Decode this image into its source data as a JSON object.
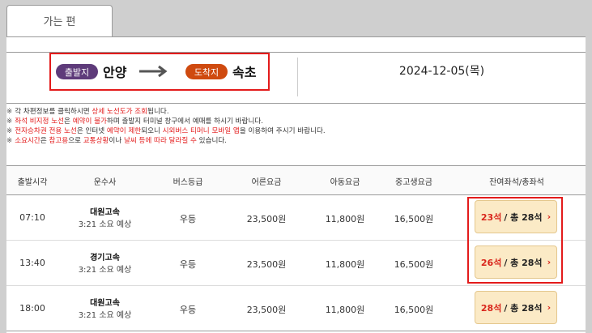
{
  "tab": {
    "label": "가는 편"
  },
  "route": {
    "departure_label": "출발지",
    "departure_city": "안양",
    "arrival_label": "도착지",
    "arrival_city": "속초",
    "date": "2024-12-05(목)"
  },
  "notices": [
    {
      "mark": "※",
      "parts": [
        [
          "각 차편정보를 클릭하시면 ",
          false
        ],
        [
          "상세 노선도가 조회",
          true
        ],
        [
          "됩니다.",
          false
        ]
      ]
    },
    {
      "mark": "※",
      "parts": [
        [
          "좌석 비지정 노선",
          true
        ],
        [
          "은 ",
          false
        ],
        [
          "예약이 불가",
          true
        ],
        [
          "하며 출발지 터미널 창구에서 예매를 하시기 바랍니다.",
          false
        ]
      ]
    },
    {
      "mark": "※",
      "parts": [
        [
          "전자승차권 전용 노선",
          true
        ],
        [
          "은 인터넷 ",
          false
        ],
        [
          "예약이 제한",
          true
        ],
        [
          "되오니 ",
          false
        ],
        [
          "시외버스 티머니 모바일 앱",
          true
        ],
        [
          "을 이용하여 주시기 바랍니다.",
          false
        ]
      ]
    },
    {
      "mark": "※",
      "parts": [
        [
          "소요시간",
          true
        ],
        [
          "은 ",
          false
        ],
        [
          "참고용",
          true
        ],
        [
          "으로 ",
          false
        ],
        [
          "교통상황",
          true
        ],
        [
          "이나 ",
          false
        ],
        [
          "날씨 등에 따라 달라질 수",
          true
        ],
        [
          " 있습니다.",
          false
        ]
      ]
    }
  ],
  "table": {
    "headers": [
      "출발시각",
      "운수사",
      "버스등급",
      "어른요금",
      "아동요금",
      "중고생요금",
      "잔여좌석/총좌석"
    ],
    "rows": [
      {
        "time": "07:10",
        "company": "대원고속",
        "duration": "3:21 소요 예상",
        "grade": "우등",
        "adult": "23,500원",
        "child": "11,800원",
        "student": "16,500원",
        "remaining": "23석",
        "total": "/ 총 28석"
      },
      {
        "time": "13:40",
        "company": "경기고속",
        "duration": "3:21 소요 예상",
        "grade": "우등",
        "adult": "23,500원",
        "child": "11,800원",
        "student": "16,500원",
        "remaining": "26석",
        "total": "/ 총 28석"
      },
      {
        "time": "18:00",
        "company": "대원고속",
        "duration": "3:21 소요 예상",
        "grade": "우등",
        "adult": "23,500원",
        "child": "11,800원",
        "student": "16,500원",
        "remaining": "28석",
        "total": "/ 총 28석"
      }
    ]
  },
  "colors": {
    "highlight": "#e31b1b",
    "departure_pill": "#5e3b7a",
    "arrival_pill": "#cf4a0f",
    "seat_button": "#fbeac6"
  },
  "icons": {
    "route_arrow": "long-right-arrow-icon",
    "seat_chevron": "chevron-right-icon"
  }
}
